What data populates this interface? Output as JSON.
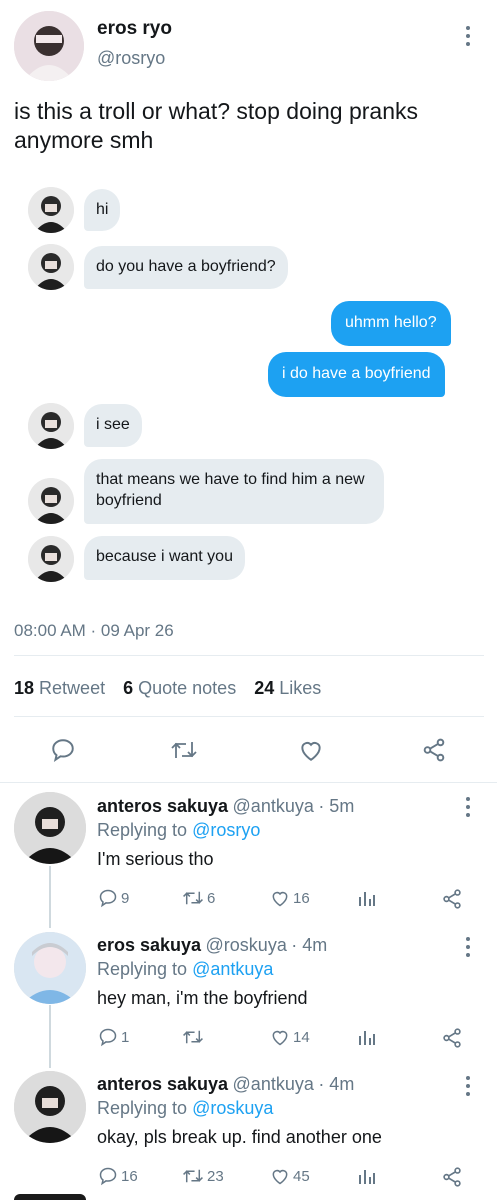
{
  "tweet": {
    "author_name": "eros ryo",
    "author_handle": "@rosryo",
    "text": "is this a troll or what? stop doing pranks anymore smh",
    "timestamp": "08:00 AM · 09 Apr 26",
    "retweets_count": "18",
    "retweets_label": "Retweet",
    "quotes_count": "6",
    "quotes_label": "Quote notes",
    "likes_count": "24",
    "likes_label": "Likes"
  },
  "chat": {
    "messages": [
      {
        "side": "left",
        "text": "hi"
      },
      {
        "side": "left",
        "text": "do you have a boyfriend?"
      },
      {
        "side": "right",
        "text": "uhmm hello?"
      },
      {
        "side": "right",
        "text": "i do have a boyfriend"
      },
      {
        "side": "left",
        "text": "i see"
      },
      {
        "side": "left",
        "text": "that means we have to find him a new boyfriend"
      },
      {
        "side": "left",
        "text": "because i want you"
      }
    ]
  },
  "replies": [
    {
      "name": "anteros sakuya",
      "handle": "@antkuya",
      "time": "· 5m",
      "replying_prefix": "Replying to",
      "replying_to": "@rosryo",
      "text": "I'm serious tho",
      "comments": "9",
      "retweets": "6",
      "likes": "16"
    },
    {
      "name": "eros sakuya",
      "handle": "@roskuya",
      "time": "· 4m",
      "replying_prefix": "Replying to",
      "replying_to": "@antkuya",
      "text": "hey man, i'm the boyfriend",
      "comments": "1",
      "retweets": "",
      "likes": "14"
    },
    {
      "name": "anteros sakuya",
      "handle": "@antkuya",
      "time": "· 4m",
      "replying_prefix": "Replying to",
      "replying_to": "@roskuya",
      "text": "okay, pls break up. find another one",
      "comments": "16",
      "retweets": "23",
      "likes": "45"
    }
  ],
  "colors": {
    "accent": "#1da1f2",
    "muted": "#657786",
    "bubble_gray": "#e6ecf0"
  }
}
